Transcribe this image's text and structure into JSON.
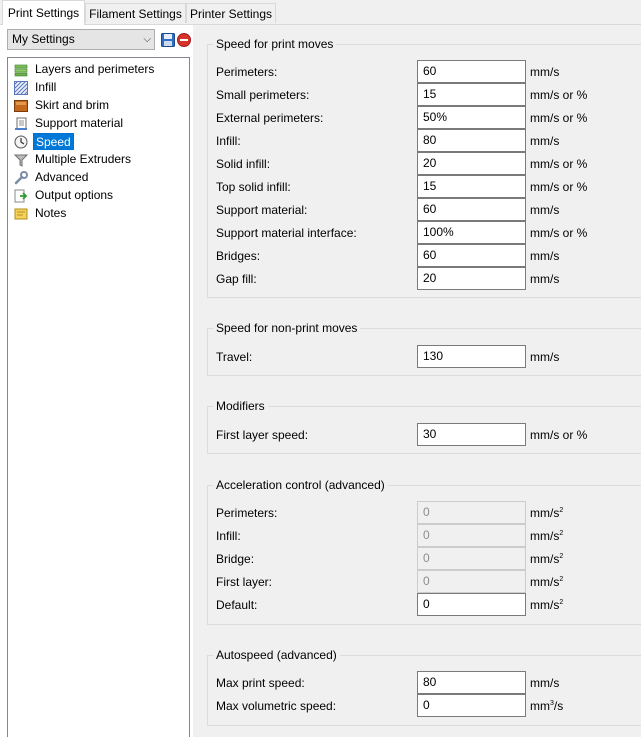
{
  "tabs": [
    {
      "label": "Print Settings",
      "active": true
    },
    {
      "label": "Filament Settings",
      "active": false
    },
    {
      "label": "Printer Settings",
      "active": false
    }
  ],
  "preset": {
    "value": "My Settings"
  },
  "sidebar": {
    "items": [
      {
        "label": "Layers and perimeters",
        "icon": "layers-icon"
      },
      {
        "label": "Infill",
        "icon": "infill-icon"
      },
      {
        "label": "Skirt and brim",
        "icon": "skirt-brim-icon"
      },
      {
        "label": "Support material",
        "icon": "support-material-icon"
      },
      {
        "label": "Speed",
        "icon": "speed-clock-icon",
        "selected": true
      },
      {
        "label": "Multiple Extruders",
        "icon": "funnel-icon"
      },
      {
        "label": "Advanced",
        "icon": "wrench-icon"
      },
      {
        "label": "Output options",
        "icon": "output-icon"
      },
      {
        "label": "Notes",
        "icon": "notes-icon"
      }
    ]
  },
  "groups": {
    "print_moves": {
      "title": "Speed for print moves",
      "rows": [
        {
          "label": "Perimeters:",
          "value": "60",
          "unit": "mm/s"
        },
        {
          "label": "Small perimeters:",
          "value": "15",
          "unit": "mm/s or %"
        },
        {
          "label": "External perimeters:",
          "value": "50%",
          "unit": "mm/s or %"
        },
        {
          "label": "Infill:",
          "value": "80",
          "unit": "mm/s"
        },
        {
          "label": "Solid infill:",
          "value": "20",
          "unit": "mm/s or %"
        },
        {
          "label": "Top solid infill:",
          "value": "15",
          "unit": "mm/s or %"
        },
        {
          "label": "Support material:",
          "value": "60",
          "unit": "mm/s"
        },
        {
          "label": "Support material interface:",
          "value": "100%",
          "unit": "mm/s or %"
        },
        {
          "label": "Bridges:",
          "value": "60",
          "unit": "mm/s"
        },
        {
          "label": "Gap fill:",
          "value": "20",
          "unit": "mm/s"
        }
      ]
    },
    "non_print_moves": {
      "title": "Speed for non-print moves",
      "rows": [
        {
          "label": "Travel:",
          "value": "130",
          "unit": "mm/s"
        }
      ]
    },
    "modifiers": {
      "title": "Modifiers",
      "rows": [
        {
          "label": "First layer speed:",
          "value": "30",
          "unit": "mm/s or %"
        }
      ]
    },
    "acceleration": {
      "title": "Acceleration control (advanced)",
      "unit_base": "mm/s",
      "unit_exp": "2",
      "rows": [
        {
          "label": "Perimeters:",
          "value": "0",
          "disabled": true
        },
        {
          "label": "Infill:",
          "value": "0",
          "disabled": true
        },
        {
          "label": "Bridge:",
          "value": "0",
          "disabled": true
        },
        {
          "label": "First layer:",
          "value": "0",
          "disabled": true
        },
        {
          "label": "Default:",
          "value": "0",
          "disabled": false
        }
      ]
    },
    "autospeed": {
      "title": "Autospeed (advanced)",
      "rows": [
        {
          "label": "Max print speed:",
          "value": "80",
          "unit": "mm/s"
        },
        {
          "label": "Max volumetric speed:",
          "value": "0",
          "unit_base": "mm",
          "unit_exp": "3",
          "unit_tail": "/s"
        }
      ]
    }
  }
}
